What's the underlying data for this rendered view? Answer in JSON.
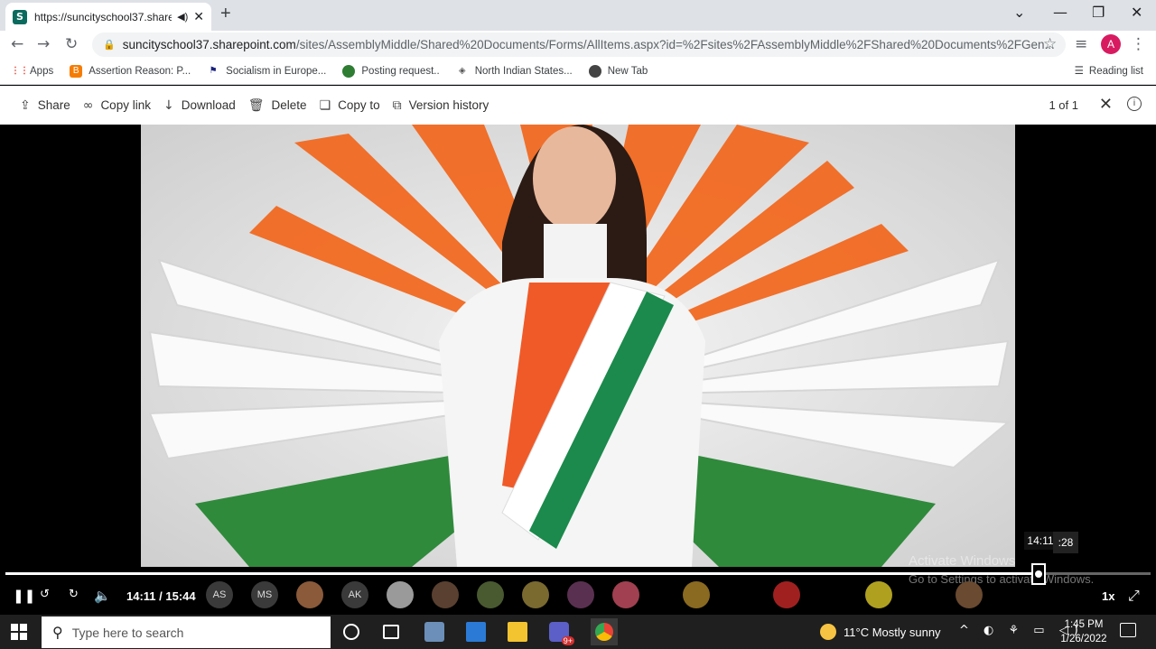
{
  "browser": {
    "tab_title": "https://suncityschool37.share",
    "favicon_letter": "S",
    "new_tab_symbol": "+",
    "url_host": "suncityschool37.sharepoint.com",
    "url_path": "/sites/AssemblyMiddle/Shared%20Documents/Forms/AllItems.aspx?id=%2Fsites%2FAssemblyMiddle%2FShared%20Documents%2FGen...",
    "profile_initial": "A",
    "bookmarks": [
      {
        "label": "Apps",
        "icon": "apps-grid-icon",
        "color": "#ea4335"
      },
      {
        "label": "Assertion Reason: P...",
        "icon": "blogger-icon",
        "color": "#f57c00"
      },
      {
        "label": "Socialism in Europe...",
        "icon": "flag-icon",
        "color": "#1a237e"
      },
      {
        "label": "Posting request..",
        "icon": "globe-icon",
        "color": "#2e7d32"
      },
      {
        "label": "North Indian States...",
        "icon": "diamond-icon",
        "color": "#555555"
      },
      {
        "label": "New Tab",
        "icon": "chrome-icon",
        "color": "#444444"
      }
    ],
    "reading_list": "Reading list"
  },
  "commandbar": {
    "items": [
      {
        "label": "Share",
        "icon": "share-icon"
      },
      {
        "label": "Copy link",
        "icon": "link-icon"
      },
      {
        "label": "Download",
        "icon": "download-icon"
      },
      {
        "label": "Delete",
        "icon": "trash-icon"
      },
      {
        "label": "Copy to",
        "icon": "copy-icon"
      },
      {
        "label": "Version history",
        "icon": "version-history-icon"
      }
    ],
    "pager": "1 of 1"
  },
  "player": {
    "current_time": "14:11",
    "total_time": "15:44",
    "time_display": "14:11 / 15:44",
    "hover_time": "14:11",
    "hover_time_partial": ":28",
    "progress": 0.902,
    "speed": "1x",
    "participants": [
      "AS",
      "MS",
      "",
      "AK",
      "",
      "",
      "",
      "",
      "",
      ""
    ],
    "watermark_title": "Activate Windows",
    "watermark_sub": "Go to Settings to activate Windows."
  },
  "taskbar": {
    "search_placeholder": "Type here to search",
    "weather": "11°C  Mostly sunny",
    "time": "1:45 PM",
    "date": "1/26/2022",
    "teams_badge": "9+"
  }
}
